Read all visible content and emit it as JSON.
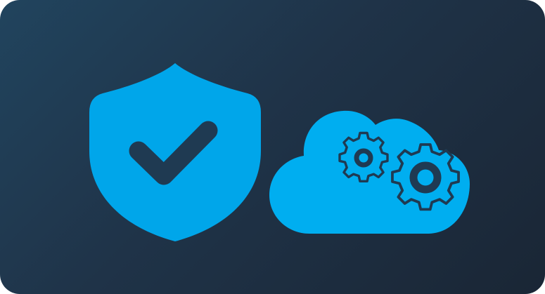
{
  "card": {
    "background_start": "#21445e",
    "background_end": "#1a2635"
  },
  "icons": {
    "shield": {
      "name": "shield-check-icon",
      "fill": "#00a6ea",
      "check_color": "#1f3a52"
    },
    "cloud": {
      "name": "cloud-gears-icon",
      "fill": "#00aef0",
      "gear_color": "#1f3a52"
    }
  }
}
